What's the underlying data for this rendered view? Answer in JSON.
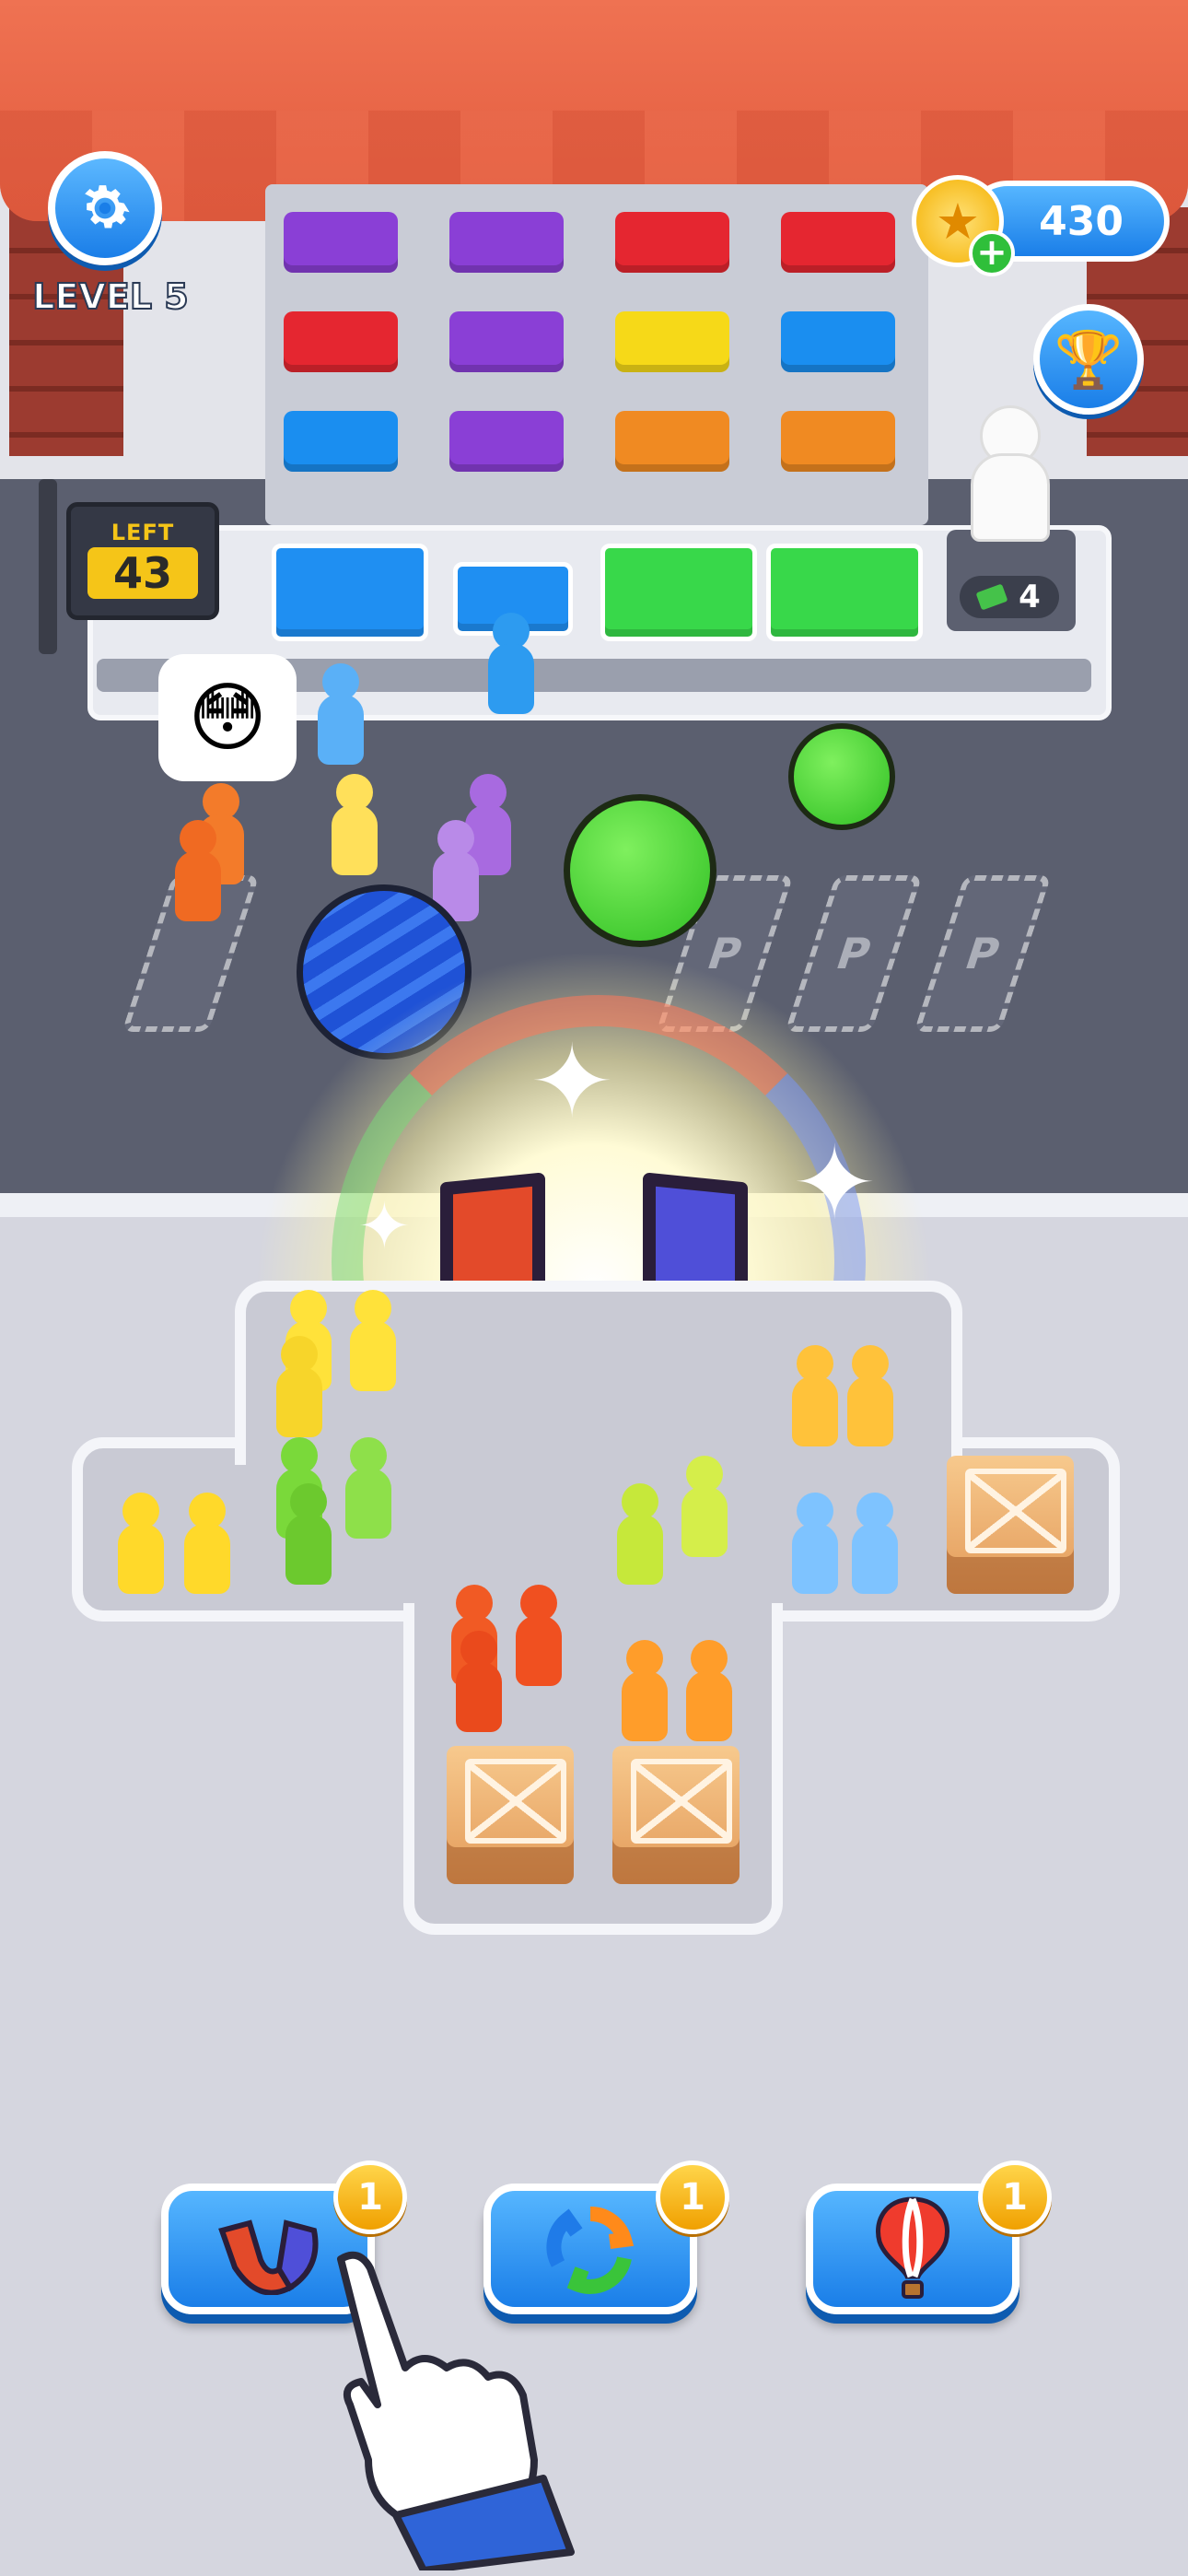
{
  "hud": {
    "level_label": "LEVEL 5",
    "coins": "430",
    "left_label": "LEFT",
    "left_count": "43",
    "cash_count": "4"
  },
  "board": {
    "parking_marker": "P"
  },
  "boosters": [
    {
      "name": "magnet",
      "icon": "magnet-icon",
      "count": "1"
    },
    {
      "name": "shuffle",
      "icon": "shuffle-icon",
      "count": "1"
    },
    {
      "name": "balloon",
      "icon": "hot-air-balloon-icon",
      "count": "1"
    }
  ],
  "colors": {
    "awning": "#ee6f4e",
    "button_blue": "#1a7ee8",
    "badge_gold": "#f0a000",
    "magnet_red": "#e34a2a",
    "magnet_blue": "#4f4fd8"
  }
}
